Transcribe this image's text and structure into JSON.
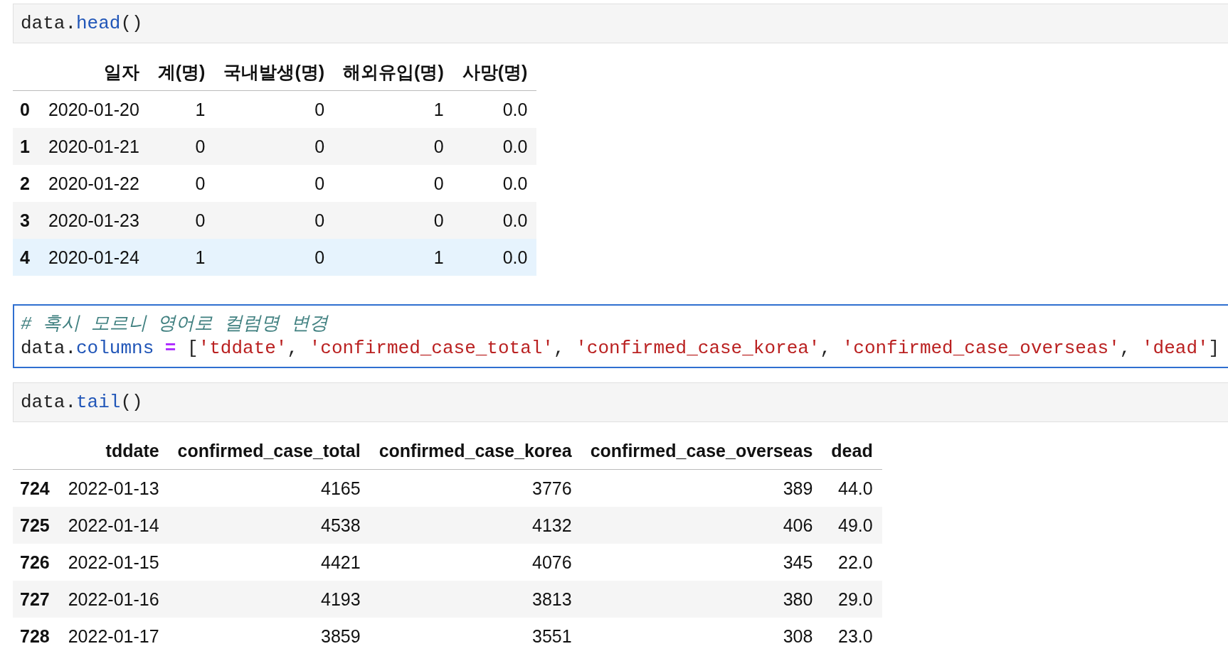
{
  "cells": [
    {
      "selected": false,
      "lines": [
        [
          {
            "kind": "plain",
            "text": "data."
          },
          {
            "kind": "attr",
            "text": "head"
          },
          {
            "kind": "plain",
            "text": "()"
          }
        ]
      ],
      "output": {
        "columns": [
          "일자",
          "계(명)",
          "국내발생(명)",
          "해외유입(명)",
          "사망(명)"
        ],
        "rows": [
          {
            "index": "0",
            "hovered": false,
            "cells": [
              "2020-01-20",
              "1",
              "0",
              "1",
              "0.0"
            ]
          },
          {
            "index": "1",
            "hovered": false,
            "cells": [
              "2020-01-21",
              "0",
              "0",
              "0",
              "0.0"
            ]
          },
          {
            "index": "2",
            "hovered": false,
            "cells": [
              "2020-01-22",
              "0",
              "0",
              "0",
              "0.0"
            ]
          },
          {
            "index": "3",
            "hovered": false,
            "cells": [
              "2020-01-23",
              "0",
              "0",
              "0",
              "0.0"
            ]
          },
          {
            "index": "4",
            "hovered": true,
            "cells": [
              "2020-01-24",
              "1",
              "0",
              "1",
              "0.0"
            ]
          }
        ]
      }
    },
    {
      "selected": true,
      "lines": [
        [
          {
            "kind": "comment",
            "text": "# 혹시 모르니 영어로 컬럼명 변경"
          }
        ],
        [
          {
            "kind": "plain",
            "text": "data."
          },
          {
            "kind": "attr",
            "text": "columns"
          },
          {
            "kind": "op",
            "text": " = "
          },
          {
            "kind": "plain",
            "text": "["
          },
          {
            "kind": "string",
            "text": "'tddate'"
          },
          {
            "kind": "plain",
            "text": ", "
          },
          {
            "kind": "string",
            "text": "'confirmed_case_total'"
          },
          {
            "kind": "plain",
            "text": ", "
          },
          {
            "kind": "string",
            "text": "'confirmed_case_korea'"
          },
          {
            "kind": "plain",
            "text": ", "
          },
          {
            "kind": "string",
            "text": "'confirmed_case_overseas'"
          },
          {
            "kind": "plain",
            "text": ", "
          },
          {
            "kind": "string",
            "text": "'dead'"
          },
          {
            "kind": "plain",
            "text": "]"
          }
        ]
      ]
    },
    {
      "selected": false,
      "lines": [
        [
          {
            "kind": "plain",
            "text": "data."
          },
          {
            "kind": "attr",
            "text": "tail"
          },
          {
            "kind": "plain",
            "text": "()"
          }
        ]
      ],
      "output": {
        "columns": [
          "tddate",
          "confirmed_case_total",
          "confirmed_case_korea",
          "confirmed_case_overseas",
          "dead"
        ],
        "rows": [
          {
            "index": "724",
            "hovered": false,
            "cells": [
              "2022-01-13",
              "4165",
              "3776",
              "389",
              "44.0"
            ]
          },
          {
            "index": "725",
            "hovered": false,
            "cells": [
              "2022-01-14",
              "4538",
              "4132",
              "406",
              "49.0"
            ]
          },
          {
            "index": "726",
            "hovered": false,
            "cells": [
              "2022-01-15",
              "4421",
              "4076",
              "345",
              "22.0"
            ]
          },
          {
            "index": "727",
            "hovered": false,
            "cells": [
              "2022-01-16",
              "4193",
              "3813",
              "380",
              "29.0"
            ]
          },
          {
            "index": "728",
            "hovered": false,
            "cells": [
              "2022-01-17",
              "3859",
              "3551",
              "308",
              "23.0"
            ]
          }
        ]
      }
    }
  ]
}
